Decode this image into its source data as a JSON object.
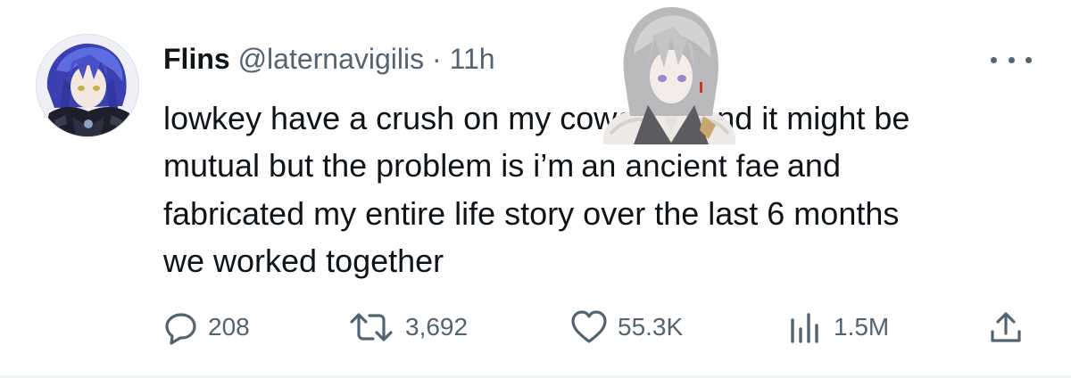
{
  "tweet": {
    "display_name": "Flins",
    "handle": "@laternavigilis",
    "separator": "·",
    "time": "11h",
    "text_lines": [
      "lowkey have a crush on my coworker and it might be",
      "mutual but the problem is i’m",
      "an ancient fae",
      "and",
      "fabricated my entire life story over the last 6 months",
      "we worked together"
    ]
  },
  "actions": {
    "replies": "208",
    "reposts": "3,692",
    "likes": "55.3K",
    "views": "1.5M"
  },
  "icons": {
    "more": "more-horizontal-icon",
    "reply": "reply-bubble-icon",
    "repost": "repost-arrows-icon",
    "like": "heart-icon",
    "views": "views-bar-chart-icon",
    "share": "share-upload-icon"
  },
  "colors": {
    "text": "#0f1419",
    "secondary": "#536471"
  }
}
